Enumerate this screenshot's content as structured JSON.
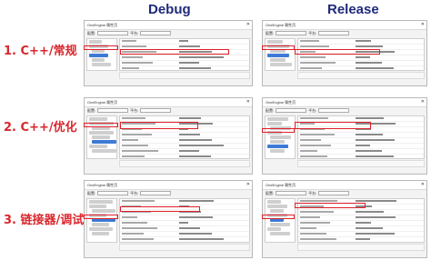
{
  "headings": {
    "debug": "Debug",
    "release": "Release"
  },
  "steps": [
    "1. C++/常规",
    "2. C++/优化",
    "3. 链接器/调试"
  ],
  "dialog": {
    "title": "OneEngine 属性页",
    "close_glyph": "✕",
    "config_label": "配置:",
    "platform_label": "平台:"
  },
  "colors": {
    "heading": "#1f2a7a",
    "step_label": "#d9262c",
    "highlight": "#e0202a",
    "tree_selection": "#3d7ad6"
  }
}
